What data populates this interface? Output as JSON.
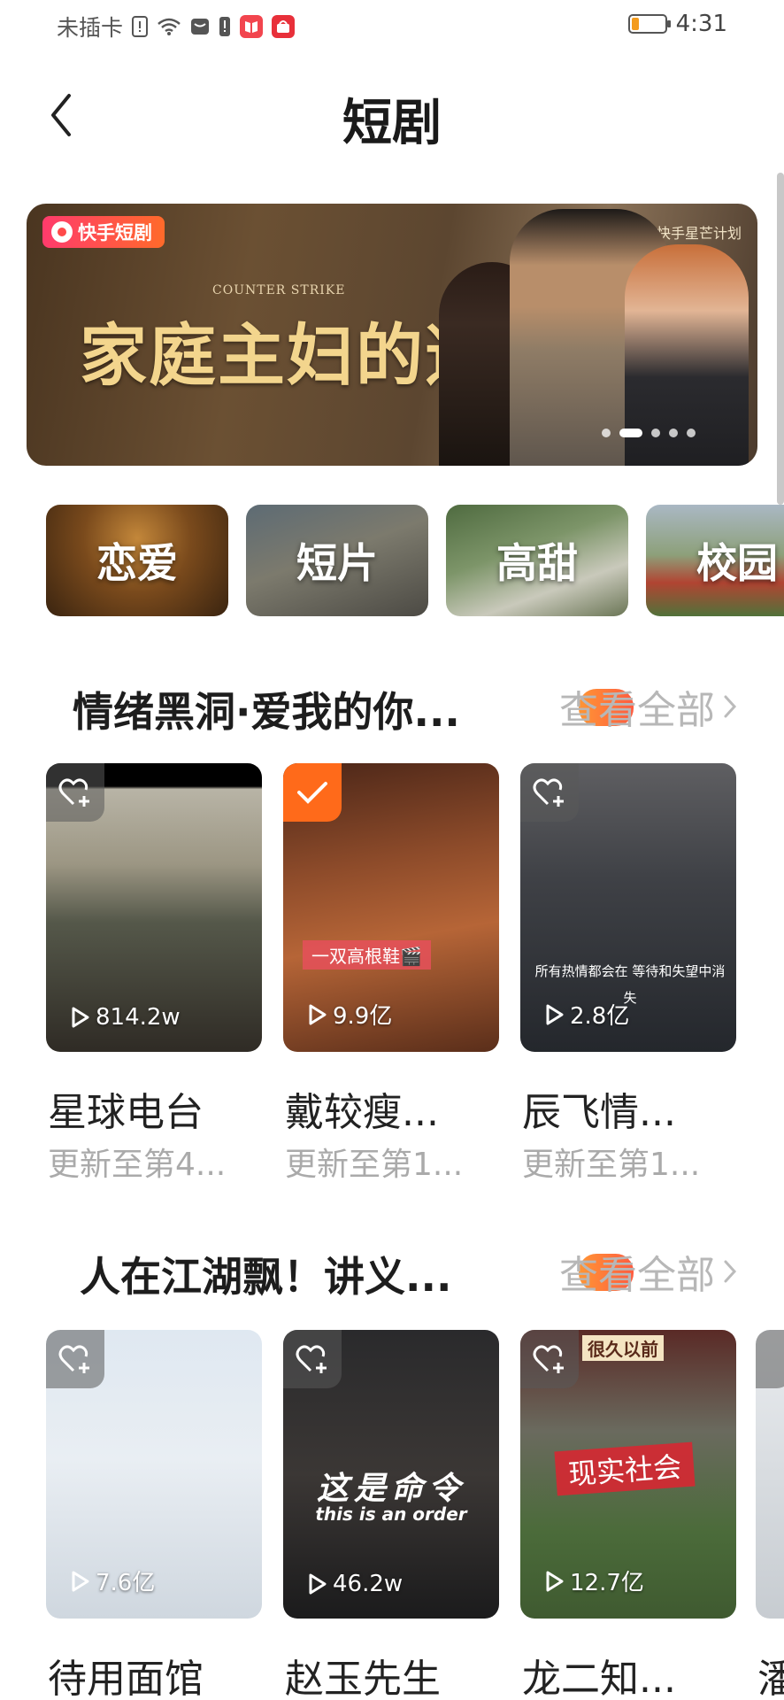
{
  "status_bar": {
    "carrier": "未插卡",
    "time": "4:31",
    "battery_level": 0.22,
    "battery_color": "#f39b1d"
  },
  "header": {
    "title": "短剧",
    "back_icon": "chevron-left-icon"
  },
  "banner": {
    "brand": "快手短剧",
    "subtitle": "COUNTER STRIKE",
    "title": "家庭主妇的逆袭",
    "plan_label": "快手星芒计划",
    "page_index": 2,
    "page_count": 5
  },
  "categories": [
    {
      "label": "恋爱"
    },
    {
      "label": "短片"
    },
    {
      "label": "高甜"
    },
    {
      "label": "校园"
    }
  ],
  "sections": [
    {
      "title": "情绪黑洞·爱我的你...",
      "see_all_label": "查看全部",
      "items": [
        {
          "title": "星球电台",
          "subtitle": "更新至第4...",
          "plays": "814.2w",
          "favorited": false,
          "overlay": ""
        },
        {
          "title": "戴较瘦...",
          "subtitle": "更新至第1...",
          "plays": "9.9亿",
          "favorited": true,
          "overlay": "一双高根鞋🎬"
        },
        {
          "title": "辰飞情...",
          "subtitle": "更新至第1...",
          "plays": "2.8亿",
          "favorited": false,
          "overlay": "所有热情都会在 等待和失望中消失"
        }
      ]
    },
    {
      "title": "人在江湖飘！讲义...",
      "see_all_label": "查看全部",
      "items": [
        {
          "title": "待用面馆",
          "plays": "7.6亿",
          "favorited": false,
          "overlay": ""
        },
        {
          "title": "赵玉先生",
          "plays": "46.2w",
          "favorited": false,
          "overlay": "这是命令",
          "overlay_en": "this is an order"
        },
        {
          "title": "龙二知...",
          "plays": "12.7亿",
          "favorited": false,
          "overlay": "现实社会",
          "sign": "很久以前"
        },
        {
          "title": "潘"
        }
      ]
    }
  ],
  "colors": {
    "accent": "#ff6a1a",
    "brand_gradient_start": "#ff3b6c",
    "brand_gradient_end": "#ff6a2a"
  }
}
